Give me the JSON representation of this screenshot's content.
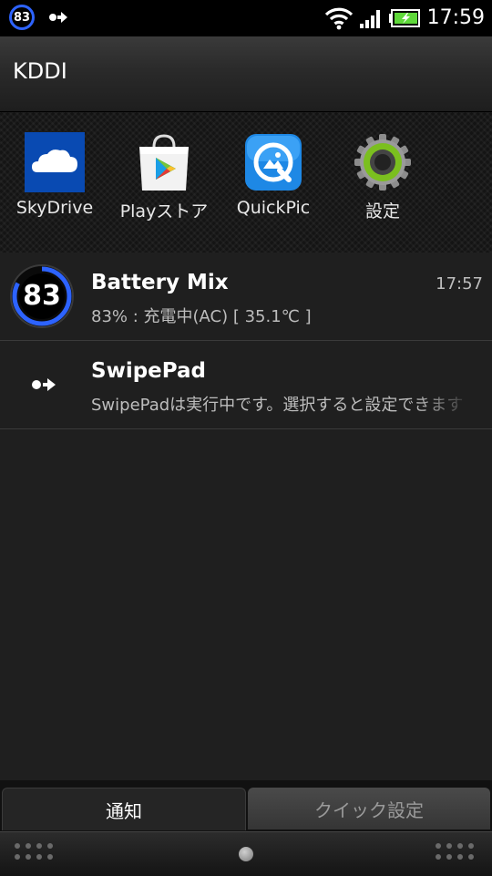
{
  "status_bar": {
    "battery_badge": "83",
    "time": "17:59"
  },
  "header": {
    "carrier": "KDDI"
  },
  "shortcuts": [
    {
      "label": "SkyDrive",
      "icon": "skydrive-cloud-icon"
    },
    {
      "label": "Playストア",
      "icon": "play-store-icon"
    },
    {
      "label": "QuickPic",
      "icon": "quickpic-icon"
    },
    {
      "label": "設定",
      "icon": "settings-gear-icon"
    }
  ],
  "notifications": [
    {
      "icon": "battery-mix-83-icon",
      "badge": "83",
      "title": "Battery Mix",
      "text": "83% : 充電中(AC) [ 35.1℃ ]",
      "time": "17:57"
    },
    {
      "icon": "swipepad-arrow-icon",
      "title": "SwipePad",
      "text": "SwipePadは実行中です。選択すると設定できます"
    }
  ],
  "tabs": {
    "notifications": "通知",
    "quick_settings": "クイック設定"
  },
  "colors": {
    "accent_blue": "#2d63ff",
    "battery_green": "#5fd83a"
  }
}
